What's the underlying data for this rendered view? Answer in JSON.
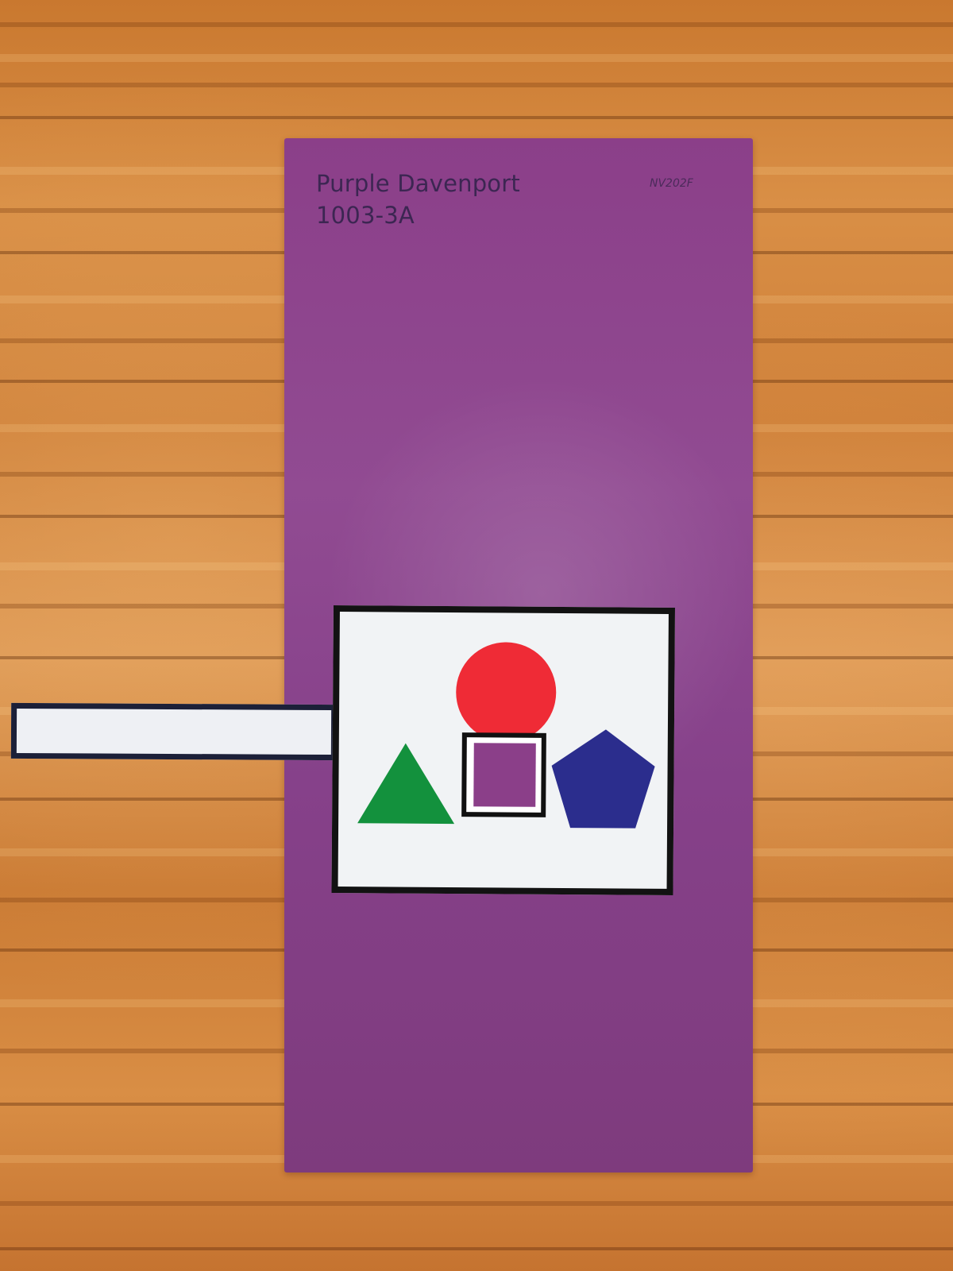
{
  "scene": {
    "background": "wooden table",
    "colors": {
      "wood": "#d8893a",
      "card_purple": "#8b3f89",
      "card_text": "#3c2652",
      "panel_white": "#f1f3f5",
      "border_black": "#121212",
      "red_circle": "#ef2b36",
      "green_triangle": "#13913d",
      "blue_pentagon": "#2b2d8d",
      "navy_border": "#1c2038"
    }
  },
  "paint_card": {
    "name": "Purple Davenport",
    "number": "1003-3A",
    "code": "NV202F"
  },
  "shape_panel": {
    "shapes": [
      {
        "name": "red-circle",
        "shape": "circle",
        "color": "#ef2b36"
      },
      {
        "name": "green-triangle",
        "shape": "triangle",
        "color": "#13913d"
      },
      {
        "name": "square-cutout",
        "shape": "square window",
        "color": "#8b3f89"
      },
      {
        "name": "blue-pentagon",
        "shape": "pentagon",
        "color": "#2b2d8d"
      }
    ]
  }
}
